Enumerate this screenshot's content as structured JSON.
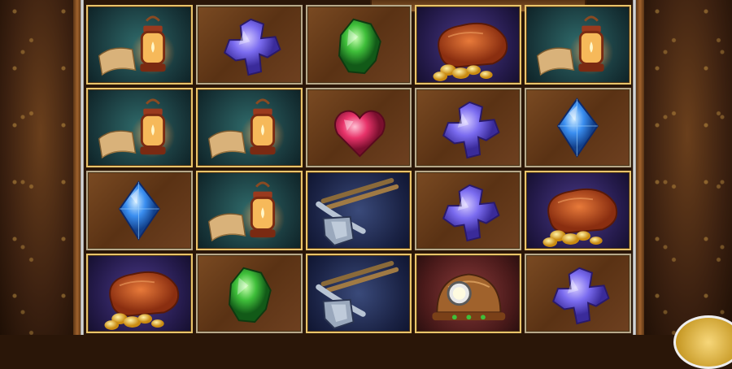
{
  "game": {
    "top_banner": "",
    "symbols": {
      "lantern": "lantern-icon",
      "purple_gem": "purple-clover-gem-icon",
      "green_gem": "green-gem-icon",
      "red_gem": "red-heart-gem-icon",
      "blue_gem": "blue-diamond-gem-icon",
      "gold_sack": "gold-sack-icon",
      "pickaxe": "pickaxe-shovel-icon",
      "helmet": "miner-helmet-icon"
    },
    "grid": [
      [
        "lantern",
        "purple_gem",
        "green_gem",
        "gold_sack",
        "lantern"
      ],
      [
        "lantern",
        "lantern",
        "red_gem",
        "purple_gem",
        "blue_gem"
      ],
      [
        "blue_gem",
        "lantern",
        "pickaxe",
        "purple_gem",
        "gold_sack"
      ],
      [
        "gold_sack",
        "green_gem",
        "pickaxe",
        "helmet",
        "purple_gem"
      ]
    ],
    "colors": {
      "frame_wood": "#8b5a2b",
      "gold_accent": "#e9c46a",
      "purple_gem": "#7b6cf0",
      "green_gem": "#3fbf3a",
      "red_gem": "#e8336a",
      "blue_gem": "#3a8ef0"
    }
  }
}
